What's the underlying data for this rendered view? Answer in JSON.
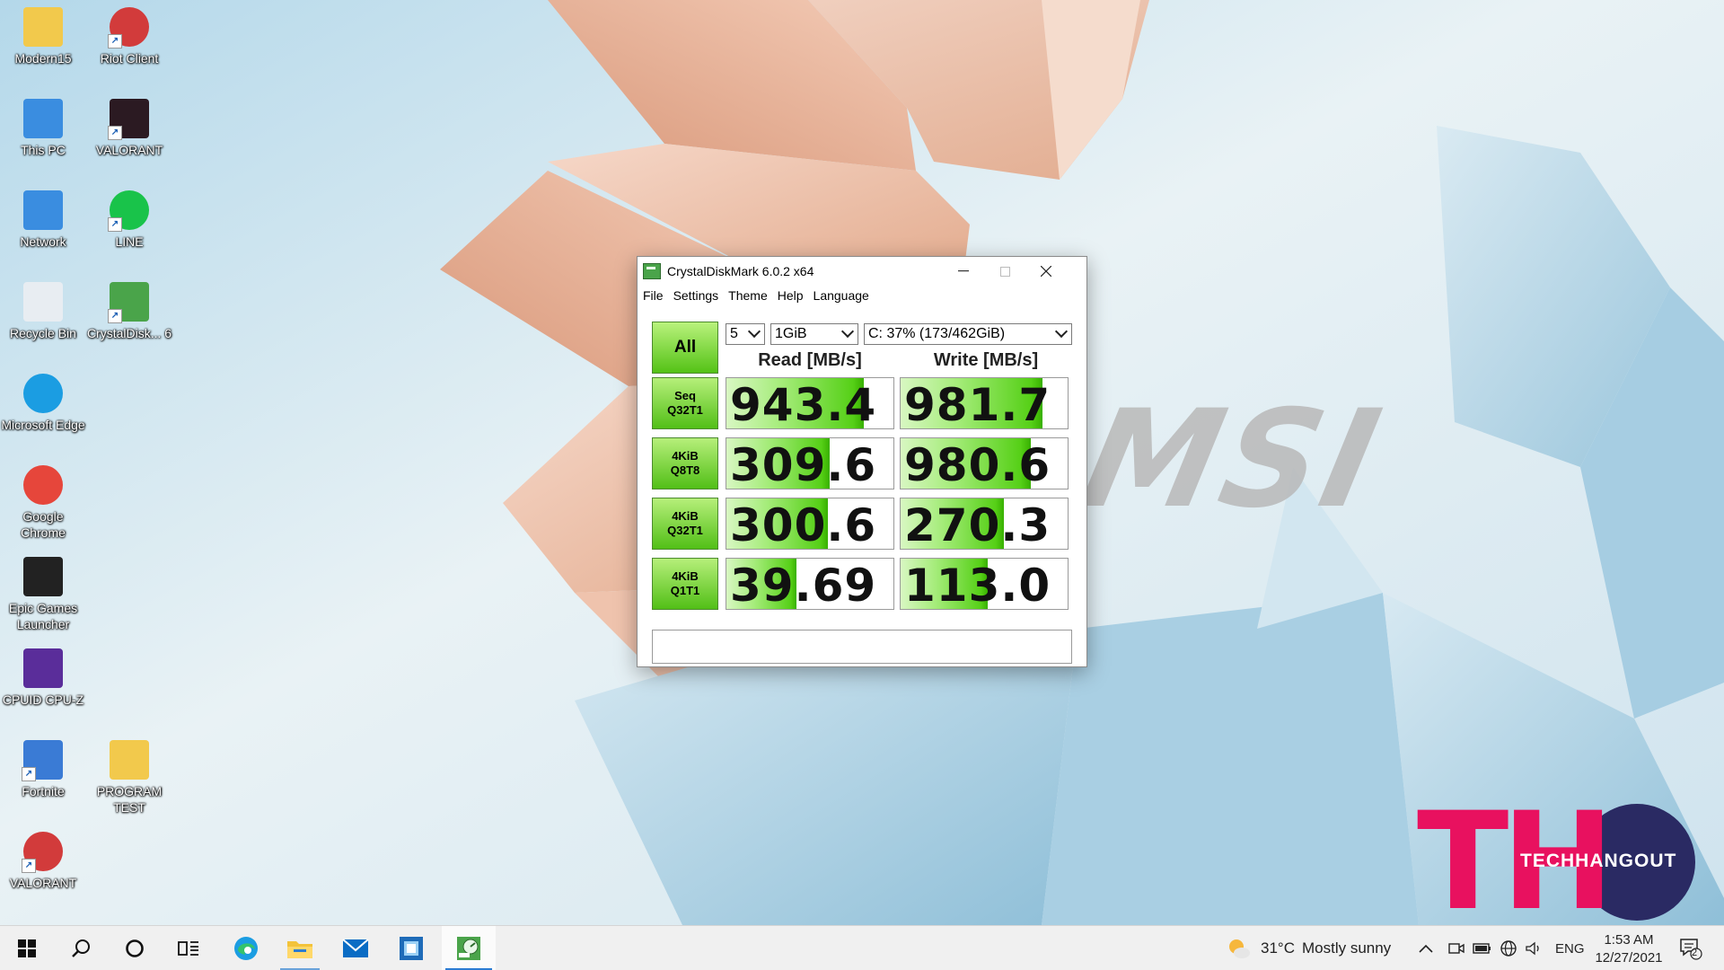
{
  "desktop": {
    "icons": [
      {
        "label": "Modern15",
        "icon": "user-folder-icon"
      },
      {
        "label": "Riot Client",
        "icon": "riot-client-icon"
      },
      {
        "label": "This PC",
        "icon": "this-pc-icon"
      },
      {
        "label": "VALORANT",
        "icon": "valorant-icon"
      },
      {
        "label": "Network",
        "icon": "network-icon"
      },
      {
        "label": "LINE",
        "icon": "line-icon"
      },
      {
        "label": "Recycle Bin",
        "icon": "recycle-bin-icon"
      },
      {
        "label": "CrystalDisk... 6",
        "icon": "crystaldiskmark-icon"
      },
      {
        "label": "Microsoft Edge",
        "icon": "edge-icon"
      },
      {
        "label": "Google Chrome",
        "icon": "chrome-icon"
      },
      {
        "label": "Epic Games Launcher",
        "icon": "epic-games-icon"
      },
      {
        "label": "CPUID CPU-Z",
        "icon": "cpu-z-icon"
      },
      {
        "label": "Fortnite",
        "icon": "fortnite-icon"
      },
      {
        "label": "PROGRAM TEST",
        "icon": "folder-icon"
      },
      {
        "label": "VALORANT",
        "icon": "riot-valorant-icon"
      }
    ]
  },
  "window": {
    "title": "CrystalDiskMark 6.0.2 x64",
    "menu": [
      "File",
      "Settings",
      "Theme",
      "Help",
      "Language"
    ],
    "controls": {
      "all_label": "All",
      "count": "5",
      "size": "1GiB",
      "drive": "C: 37% (173/462GiB)"
    },
    "headers": {
      "read": "Read [MB/s]",
      "write": "Write [MB/s]"
    },
    "rows": [
      {
        "label1": "Seq",
        "label2": "Q32T1",
        "read": "943.4",
        "write": "981.7",
        "read_fill": 0.82,
        "write_fill": 0.85
      },
      {
        "label1": "4KiB",
        "label2": "Q8T8",
        "read": "309.6",
        "write": "980.6",
        "read_fill": 0.62,
        "write_fill": 0.78
      },
      {
        "label1": "4KiB",
        "label2": "Q32T1",
        "read": "300.6",
        "write": "270.3",
        "read_fill": 0.61,
        "write_fill": 0.62
      },
      {
        "label1": "4KiB",
        "label2": "Q1T1",
        "read": "39.69",
        "write": "113.0",
        "read_fill": 0.42,
        "write_fill": 0.52
      }
    ],
    "comment": ""
  },
  "watermark": {
    "letters": "TH",
    "text": "TECHHANGOUT"
  },
  "wallpaper_logo": "msi",
  "taskbar": {
    "apps": [
      "start-icon",
      "search-icon",
      "cortana-icon",
      "task-view-icon",
      "edge-icon",
      "file-explorer-icon",
      "mail-icon",
      "photos-icon",
      "crystaldiskmark-icon"
    ],
    "weather": {
      "temp": "31°C",
      "desc": "Mostly sunny"
    },
    "lang": "ENG",
    "time": "1:53 AM",
    "date": "12/27/2021",
    "notifications": "2"
  },
  "colors": {
    "accent": "#2b7cd3",
    "cdm_green": "#52bf17",
    "th_pink": "#e8115f",
    "th_navy": "#2a2a63"
  }
}
